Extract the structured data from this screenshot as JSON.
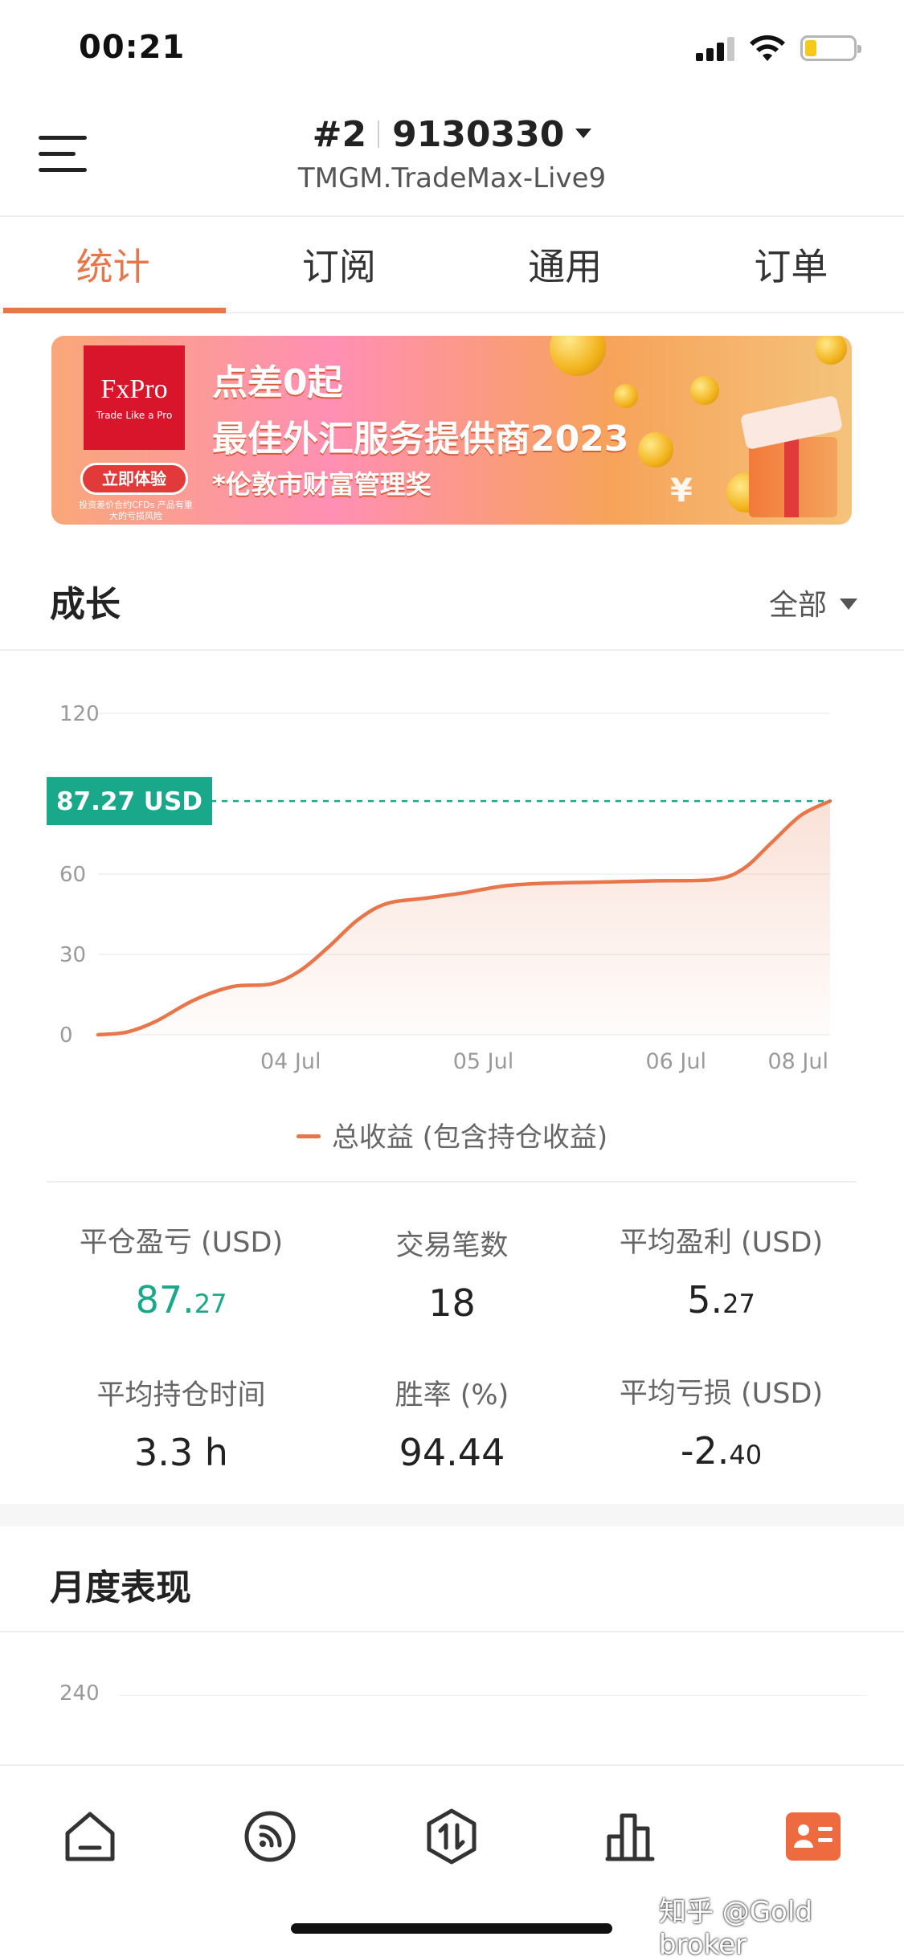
{
  "status_bar": {
    "time": "00:21"
  },
  "header": {
    "account_prefix": "#2",
    "account_number": "9130330",
    "server": "TMGM.TradeMax-Live9"
  },
  "tabs": [
    {
      "label": "统计",
      "active": true
    },
    {
      "label": "订阅",
      "active": false
    },
    {
      "label": "通用",
      "active": false
    },
    {
      "label": "订单",
      "active": false
    }
  ],
  "banner": {
    "brand": "FxPro",
    "brand_tagline": "Trade Like a Pro",
    "cta": "立即体验",
    "disclaimer": "投资差价合约CFDs 产品有重大的亏损风险",
    "line1": "点差0起",
    "line2": "最佳外汇服务提供商2023",
    "line3": "*伦敦市财富管理奖",
    "currency_symbol": "¥"
  },
  "growth": {
    "title": "成长",
    "filter": "全部"
  },
  "chart_data": {
    "type": "area",
    "title": "",
    "xlabel": "",
    "ylabel": "",
    "ylim": [
      0,
      120
    ],
    "yticks": [
      0,
      30,
      60,
      120
    ],
    "x_tick_labels": [
      {
        "t": 1.0,
        "label": "04 Jul"
      },
      {
        "t": 2.0,
        "label": "05 Jul"
      },
      {
        "t": 3.0,
        "label": "06 Jul"
      },
      {
        "t": 3.8,
        "label": "08 Jul"
      }
    ],
    "xlim": [
      0,
      3.8
    ],
    "current_value_label": "87.27 USD",
    "current_value": 87.27,
    "series": [
      {
        "name": "总收益 (包含持仓收益)",
        "color": "#e8764a",
        "points": [
          [
            0.0,
            0.0
          ],
          [
            0.15,
            1.0
          ],
          [
            0.3,
            5.0
          ],
          [
            0.5,
            13.0
          ],
          [
            0.7,
            18.0
          ],
          [
            0.9,
            19.0
          ],
          [
            1.05,
            24.0
          ],
          [
            1.2,
            33.0
          ],
          [
            1.35,
            43.0
          ],
          [
            1.5,
            49.0
          ],
          [
            1.7,
            51.0
          ],
          [
            1.9,
            53.0
          ],
          [
            2.1,
            55.5
          ],
          [
            2.3,
            56.5
          ],
          [
            2.6,
            57.0
          ],
          [
            2.9,
            57.5
          ],
          [
            3.2,
            58.0
          ],
          [
            3.35,
            62.0
          ],
          [
            3.5,
            72.0
          ],
          [
            3.65,
            82.0
          ],
          [
            3.8,
            87.27
          ]
        ]
      }
    ]
  },
  "stats": [
    {
      "label": "平仓盈亏 (USD)",
      "major": "87.",
      "minor": "27",
      "color": "green"
    },
    {
      "label": "交易笔数",
      "major": "18",
      "minor": "",
      "color": "default"
    },
    {
      "label": "平均盈利 (USD)",
      "major": "5.",
      "minor": "27",
      "color": "default"
    },
    {
      "label": "平均持仓时间",
      "major": "3.3 h",
      "minor": "",
      "color": "default"
    },
    {
      "label": "胜率 (%)",
      "major": "94.44",
      "minor": "",
      "color": "default"
    },
    {
      "label": "平均亏损 (USD)",
      "major": "-2.",
      "minor": "40",
      "color": "default"
    }
  ],
  "monthly": {
    "title": "月度表现",
    "first_tick": "240"
  },
  "bottom_nav": [
    {
      "icon": "home-icon"
    },
    {
      "icon": "signal-feed-icon"
    },
    {
      "icon": "trade-icon"
    },
    {
      "icon": "chart-bars-icon"
    },
    {
      "icon": "account-card-icon",
      "active": true
    }
  ],
  "watermark": "知乎 @Gold broker",
  "colors": {
    "accent": "#e8764a",
    "profit_green": "#1aa88a",
    "value_badge": "#1aa88a"
  }
}
